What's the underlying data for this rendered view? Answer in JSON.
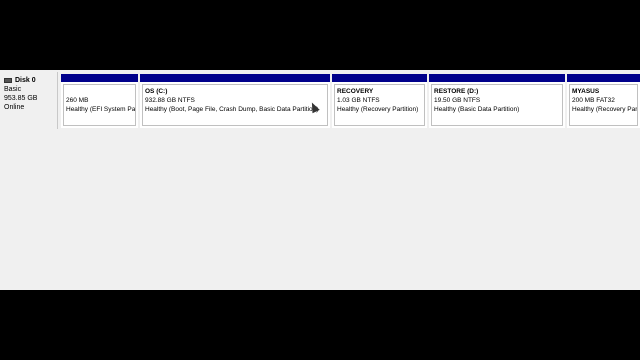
{
  "disk": {
    "name": "Disk 0",
    "type": "Basic",
    "size": "953.85 GB",
    "status": "Online",
    "icon": "disk-icon"
  },
  "partitions": [
    {
      "name": "",
      "size_fs": "260 MB",
      "status": "Healthy (EFI System Pa"
    },
    {
      "name": "OS  (C:)",
      "size_fs": "932.88 GB NTFS",
      "status": "Healthy (Boot, Page File, Crash Dump, Basic Data Partition)"
    },
    {
      "name": "RECOVERY",
      "size_fs": "1.03 GB NTFS",
      "status": "Healthy (Recovery Partition)"
    },
    {
      "name": "RESTORE  (D:)",
      "size_fs": "19.50 GB NTFS",
      "status": "Healthy (Basic Data Partition)"
    },
    {
      "name": "MYASUS",
      "size_fs": "200 MB FAT32",
      "status": "Healthy (Recovery Partition)"
    }
  ],
  "colors": {
    "partition_bar": "#00008b",
    "background": "#f0f0f0"
  }
}
